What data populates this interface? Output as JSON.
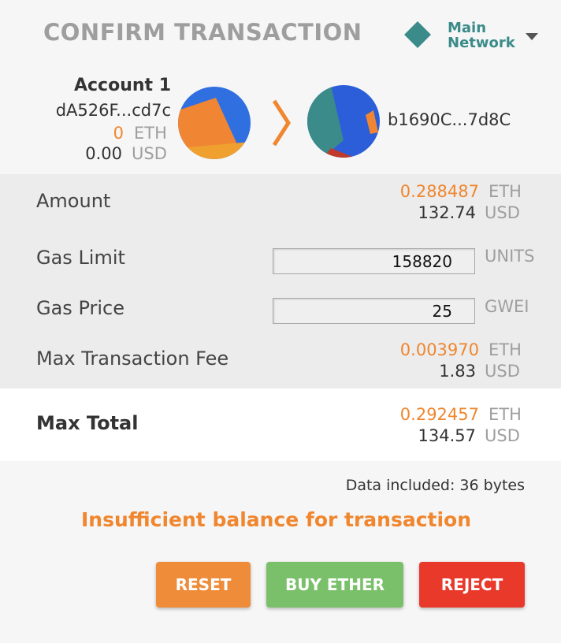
{
  "header": {
    "title": "CONFIRM TRANSACTION",
    "network_line1": "Main",
    "network_line2": "Network"
  },
  "from": {
    "name": "Account 1",
    "address": "dA526F...cd7c",
    "eth_value": "0",
    "eth_unit": "ETH",
    "usd_value": "0.00",
    "usd_unit": "USD"
  },
  "to": {
    "address": "b1690C...7d8C"
  },
  "details": {
    "amount_label": "Amount",
    "amount_eth": "0.288487",
    "amount_eth_unit": "ETH",
    "amount_usd": "132.74",
    "amount_usd_unit": "USD",
    "gas_limit_label": "Gas Limit",
    "gas_limit_value": "158820",
    "gas_limit_unit": "UNITS",
    "gas_price_label": "Gas Price",
    "gas_price_value": "25",
    "gas_price_unit": "GWEI",
    "max_fee_label": "Max Transaction Fee",
    "max_fee_eth": "0.003970",
    "max_fee_eth_unit": "ETH",
    "max_fee_usd": "1.83",
    "max_fee_usd_unit": "USD"
  },
  "total": {
    "label": "Max Total",
    "eth": "0.292457",
    "eth_unit": "ETH",
    "usd": "134.57",
    "usd_unit": "USD"
  },
  "footer": {
    "data_included": "Data included: 36 bytes",
    "error": "Insufficient balance for transaction"
  },
  "buttons": {
    "reset": "RESET",
    "buy_ether": "BUY ETHER",
    "reject": "REJECT"
  },
  "colors": {
    "accent_orange": "#f0862e",
    "network_teal": "#3a8b89",
    "reset_bg": "#ef8c3a",
    "buy_bg": "#7ac06a",
    "reject_bg": "#e8392b"
  },
  "icons": {
    "network": "diamond-icon",
    "network_dropdown": "caret-down-icon",
    "transfer": "chevron-right-icon",
    "from_identicon": "identicon",
    "to_identicon": "identicon"
  }
}
